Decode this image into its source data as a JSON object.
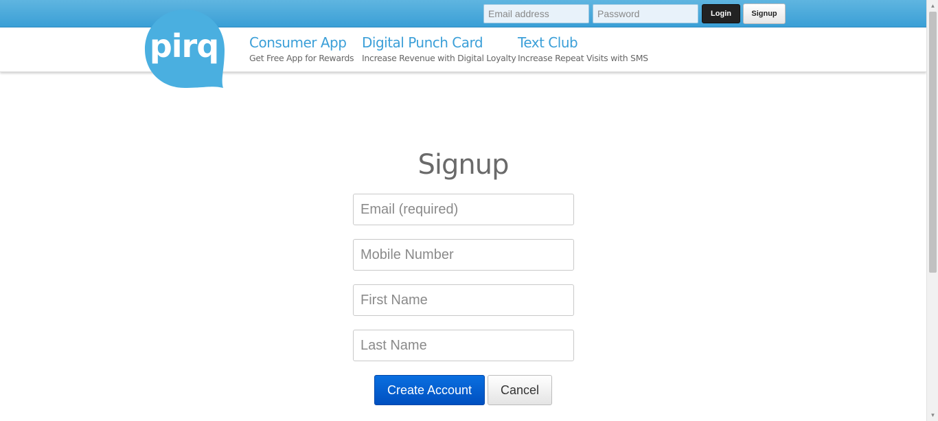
{
  "topbar": {
    "email_placeholder": "Email address",
    "password_placeholder": "Password",
    "login_label": "Login",
    "signup_label": "Signup"
  },
  "logo": {
    "text": "pirq",
    "color": "#4aafe0"
  },
  "nav": [
    {
      "title": "Consumer App",
      "subtitle": "Get Free App for Rewards"
    },
    {
      "title": "Digital Punch Card",
      "subtitle": "Increase Revenue with Digital Loyalty"
    },
    {
      "title": "Text Club",
      "subtitle": "Increase Repeat Visits with SMS"
    }
  ],
  "signup": {
    "title": "Signup",
    "email_placeholder": "Email (required)",
    "mobile_placeholder": "Mobile Number",
    "first_name_placeholder": "First Name",
    "last_name_placeholder": "Last Name",
    "create_label": "Create Account",
    "cancel_label": "Cancel"
  },
  "colors": {
    "accent": "#3b9fd8",
    "topbar": "#4aaadd",
    "primary_button": "#0a63d6"
  }
}
